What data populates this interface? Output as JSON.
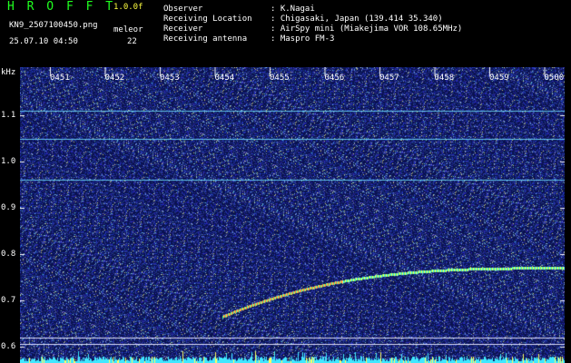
{
  "header": {
    "title": "H R O F F T",
    "version": "1.0.0f",
    "filename": "KN9_2507100450.png",
    "mode": "meleor",
    "datetime": "25.07.10 04:50",
    "count": "22",
    "metadata": [
      {
        "label": "Observer",
        "value": ": K.Nagai"
      },
      {
        "label": "Receiving Location",
        "value": ": Chigasaki, Japan (139.414 35.340)"
      },
      {
        "label": "Receiver",
        "value": ": AirSpy mini (Miakejima VOR 108.65MHz)"
      },
      {
        "label": "Receiving antenna",
        "value": ": Maspro FM-3"
      }
    ]
  },
  "spectrogram": {
    "y_unit": "kHz",
    "y_ticks": [
      "1.1",
      "1.0",
      "0.9",
      "0.8",
      "0.7",
      "0.6"
    ],
    "x_ticks": [
      "0451",
      "0452",
      "0453",
      "0454",
      "0455",
      "0456",
      "0457",
      "0458",
      "0459",
      "0500"
    ],
    "background_color": "#0a1250",
    "carrier_lines_khz": [
      1.11,
      1.05,
      0.96
    ],
    "baseline_lines_khz": [
      0.62,
      0.605
    ],
    "echo_color": "#ffd040"
  }
}
